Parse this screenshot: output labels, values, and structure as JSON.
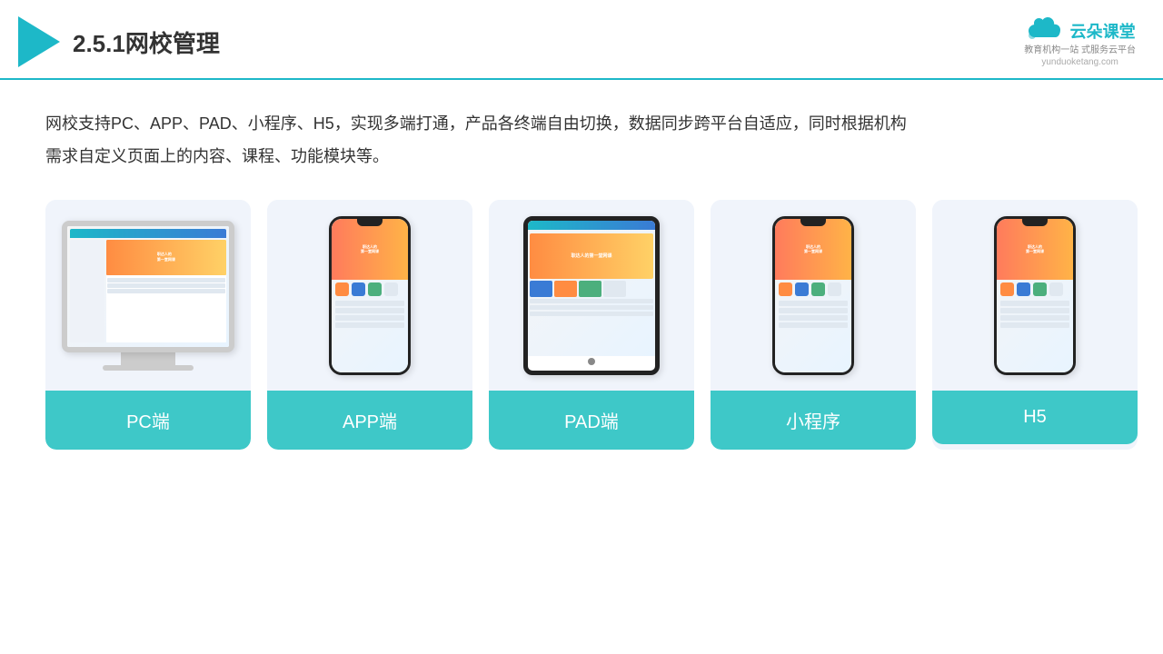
{
  "header": {
    "title": "2.5.1网校管理",
    "brand": {
      "name": "云朵课堂",
      "slogan": "教育机构一站\n式服务云平台",
      "url": "yunduoketang.com"
    }
  },
  "description": "网校支持PC、APP、PAD、小程序、H5，实现多端打通，产品各终端自由切换，数据同步跨平台自适应，同时根据机构\n需求自定义页面上的内容、课程、功能模块等。",
  "cards": [
    {
      "id": "pc",
      "label": "PC端"
    },
    {
      "id": "app",
      "label": "APP端"
    },
    {
      "id": "pad",
      "label": "PAD端"
    },
    {
      "id": "miniapp",
      "label": "小程序"
    },
    {
      "id": "h5",
      "label": "H5"
    }
  ]
}
